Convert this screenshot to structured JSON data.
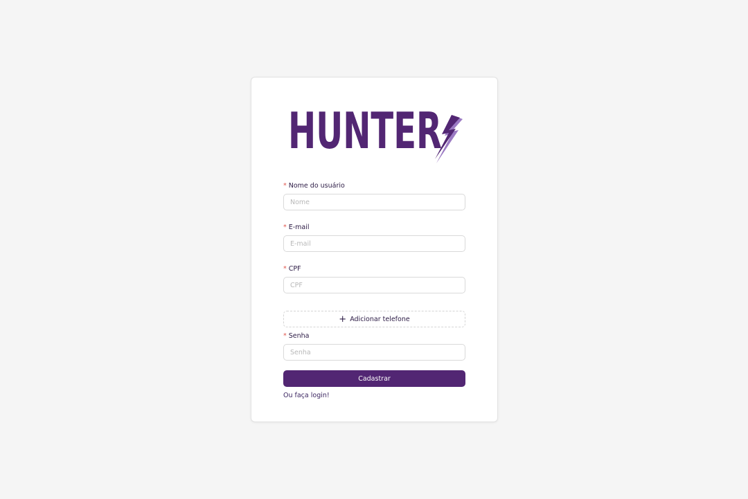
{
  "brand": {
    "logo_text": "HUNTER",
    "color": "#522673"
  },
  "form": {
    "username": {
      "label": "Nome do usuário",
      "placeholder": "Nome",
      "value": ""
    },
    "email": {
      "label": "E-mail",
      "placeholder": "E-mail",
      "value": ""
    },
    "cpf": {
      "label": "CPF",
      "placeholder": "CPF",
      "value": ""
    },
    "add_phone_label": "Adicionar telefone",
    "password": {
      "label": "Senha",
      "placeholder": "Senha",
      "value": ""
    },
    "required_mark": "*",
    "submit_label": "Cadastrar",
    "login_link": "Ou faça login!"
  },
  "icons": {
    "plus": "plus-icon",
    "logo_bolt": "lightning-bolt-icon"
  }
}
